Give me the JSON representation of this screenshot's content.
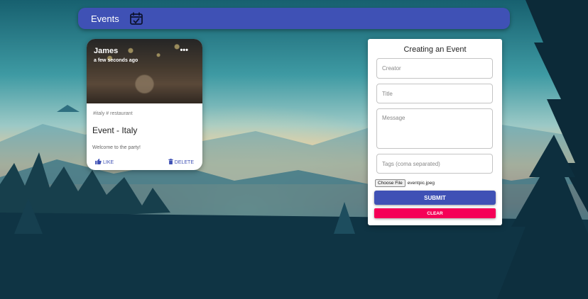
{
  "appbar": {
    "title": "Events",
    "icon": "calendar-check-icon",
    "color": "#3f51b5"
  },
  "post": {
    "author": "James",
    "time": "a few seconds ago",
    "more_icon": "more-horizontal-icon",
    "more_label": "•••",
    "tags": "#italy # restaurant",
    "title": "Event - Italy",
    "message": "Welcome to the party!",
    "like_label": "LIKE",
    "delete_label": "DELETE",
    "like_icon": "thumb-up-icon",
    "delete_icon": "trash-icon"
  },
  "form": {
    "heading": "Creating an Event",
    "creator_placeholder": "Creator",
    "title_placeholder": "Title",
    "message_placeholder": "Message",
    "tags_placeholder": "Tags (coma separated)",
    "file_button_label": "Choose File",
    "file_name": "eventpic.jpeg",
    "submit_label": "SUBMIT",
    "clear_label": "CLEAR",
    "submit_color": "#3f51b5",
    "clear_color": "#f50057"
  }
}
